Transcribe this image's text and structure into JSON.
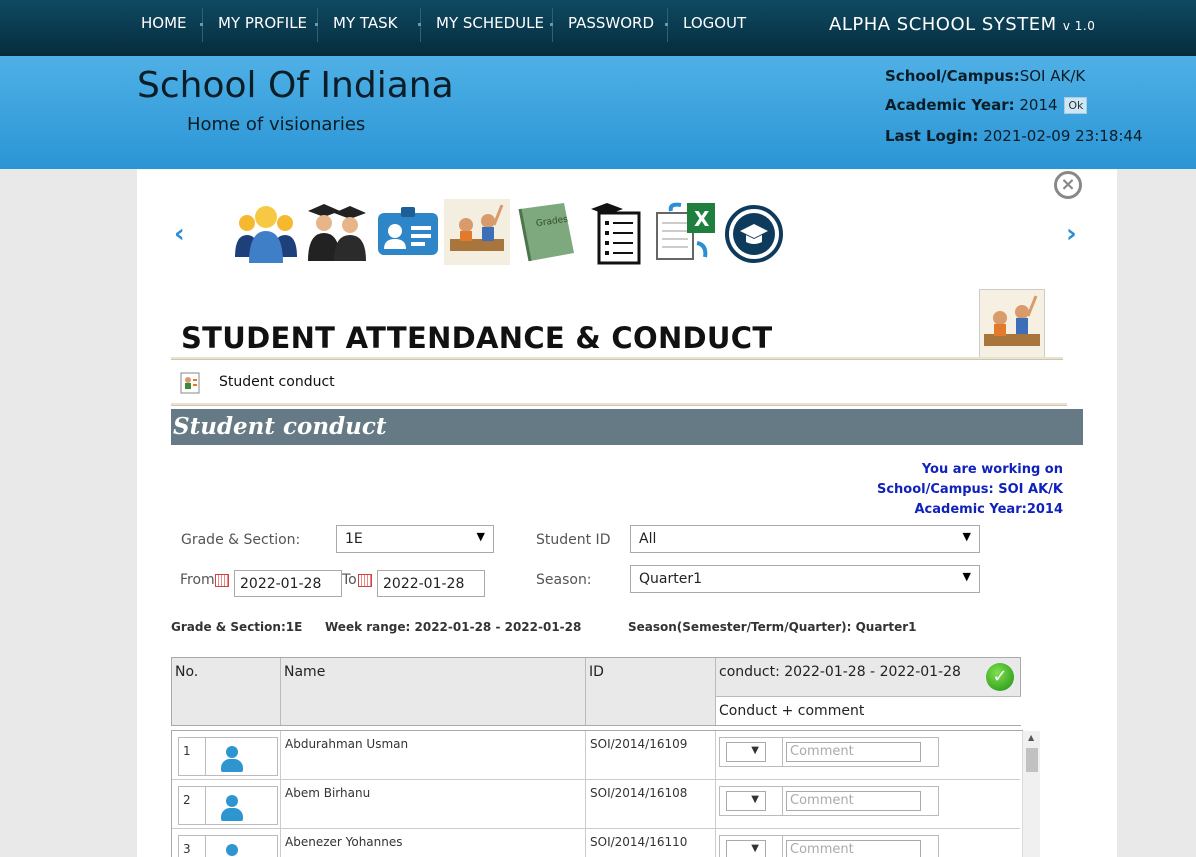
{
  "nav": {
    "items": [
      "HOME",
      "MY PROFILE",
      "MY TASK",
      "MY SCHEDULE",
      "PASSWORD",
      "LOGOUT"
    ],
    "app_title": "ALPHA SCHOOL SYSTEM",
    "app_version": "v 1.0"
  },
  "banner": {
    "school_name": "School Of Indiana",
    "tagline": "Home of visionaries",
    "campus_label": "School/Campus:",
    "campus_value": "SOI AK/K",
    "year_label": "Academic Year:",
    "year_value": "2014",
    "ok_label": "Ok",
    "login_label": "Last Login:",
    "login_value": "2021-02-09 23:18:44"
  },
  "carousel": {
    "prev": "‹",
    "next": "›",
    "close": "×",
    "icons": [
      "people-group-icon",
      "graduates-icon",
      "id-card-icon",
      "classroom-icon",
      "grades-book-icon",
      "checklist-icon",
      "excel-export-icon",
      "graduation-cap-icon"
    ],
    "book_label": "Grades"
  },
  "page": {
    "title": "STUDENT ATTENDANCE & CONDUCT",
    "breadcrumb": "Student conduct",
    "section_title": "Student conduct"
  },
  "working": {
    "line1": "You are working on",
    "line2": "School/Campus: SOI AK/K",
    "line3": "Academic Year:2014"
  },
  "filters": {
    "grade_label": "Grade & Section:",
    "grade_value": "1E",
    "student_label": "Student ID",
    "student_value": "All",
    "from_label": "From",
    "from_value": "2022-01-28",
    "to_label": "To",
    "to_value": "2022-01-28",
    "season_label": "Season:",
    "season_value": "Quarter1"
  },
  "summary": {
    "grade": "Grade & Section:1E",
    "week": "Week range: 2022-01-28 - 2022-01-28",
    "season": "Season(Semester/Term/Quarter): Quarter1"
  },
  "table": {
    "headers": {
      "no": "No.",
      "name": "Name",
      "id": "ID",
      "conduct": "conduct: 2022-01-28 - 2022-01-28",
      "conduct_sub": "Conduct + comment"
    },
    "comment_placeholder": "Comment",
    "rows": [
      {
        "no": "1",
        "name": "Abdurahman Usman",
        "id": "SOI/2014/16109"
      },
      {
        "no": "2",
        "name": "Abem Birhanu",
        "id": "SOI/2014/16108"
      },
      {
        "no": "3",
        "name": "Abenezer Yohannes",
        "id": "SOI/2014/16110"
      }
    ]
  },
  "colors": {
    "nav_bg": "#062c3c",
    "banner_bg": "#2a95d5",
    "section_bar": "#657a84",
    "working_text": "#1122bb"
  }
}
